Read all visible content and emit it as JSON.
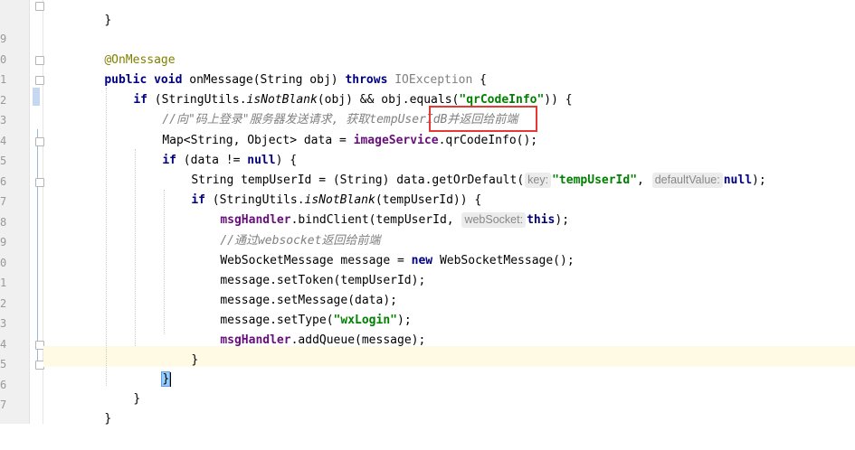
{
  "line_numbers": [
    "9",
    "0",
    "1",
    "2",
    "3",
    "4",
    "5",
    "6",
    "7",
    "8",
    "9",
    "0",
    "1",
    "2",
    "3",
    "4",
    "5",
    "6",
    "7"
  ],
  "code": {
    "l0": {
      "brace": "}"
    },
    "annotation": "@OnMessage",
    "l2": {
      "public": "public",
      "void": "void",
      "sig": " onMessage(String obj) ",
      "throws": "throws",
      "exc": "IOException",
      "open": " {"
    },
    "l3": {
      "if": "if",
      "a": " (StringUtils.",
      "method": "isNotBlank",
      "b": "(obj) && obj.equals(",
      "str": "\"qrCodeInfo\"",
      "c": ")) {"
    },
    "l4": {
      "comment": "//向\"码上登录\"服务器发送请求, 获取tempUserIdB并返回给前端"
    },
    "l5": {
      "a": "Map<String, Object> data = ",
      "field": "imageService",
      "b": ".",
      "boxed": "qrCodeInfo();"
    },
    "l6": {
      "if": "if",
      "a": " (data != ",
      "null": "null",
      "b": ") {"
    },
    "l7": {
      "a": "String tempUserId = (String) data.getOrDefault(",
      "hint1": "key:",
      "str": "\"tempUserId\"",
      "b": ",",
      "hint2": "defaultValue:",
      "null": "null",
      "c": ");"
    },
    "l8": {
      "if": "if",
      "a": " (StringUtils.",
      "method": "isNotBlank",
      "b": "(tempUserId)) {"
    },
    "l9": {
      "field": "msgHandler",
      "a": ".bindClient(tempUserId,",
      "hint": "webSocket:",
      "this": "this",
      "b": ");"
    },
    "l10": {
      "comment": "//通过websocket返回给前端"
    },
    "l11": {
      "a": "WebSocketMessage message = ",
      "new": "new",
      "b": " WebSocketMessage();"
    },
    "l12": {
      "a": "message.setToken(tempUserId);"
    },
    "l13": {
      "a": "message.setMessage(data);"
    },
    "l14": {
      "a": "message.setType(",
      "str": "\"wxLogin\"",
      "b": ");"
    },
    "l15": {
      "field": "msgHandler",
      "a": ".addQueue(message);"
    },
    "l16": {
      "brace": "}"
    },
    "l17": {
      "brace": "}"
    },
    "l18": {
      "brace": "}"
    },
    "l19": {
      "brace": "}"
    }
  },
  "colors": {
    "keyword": "#000080",
    "string": "#008000",
    "annotation": "#808000",
    "field": "#660e7a",
    "comment": "#808080",
    "highlight_box": "#e53935"
  }
}
